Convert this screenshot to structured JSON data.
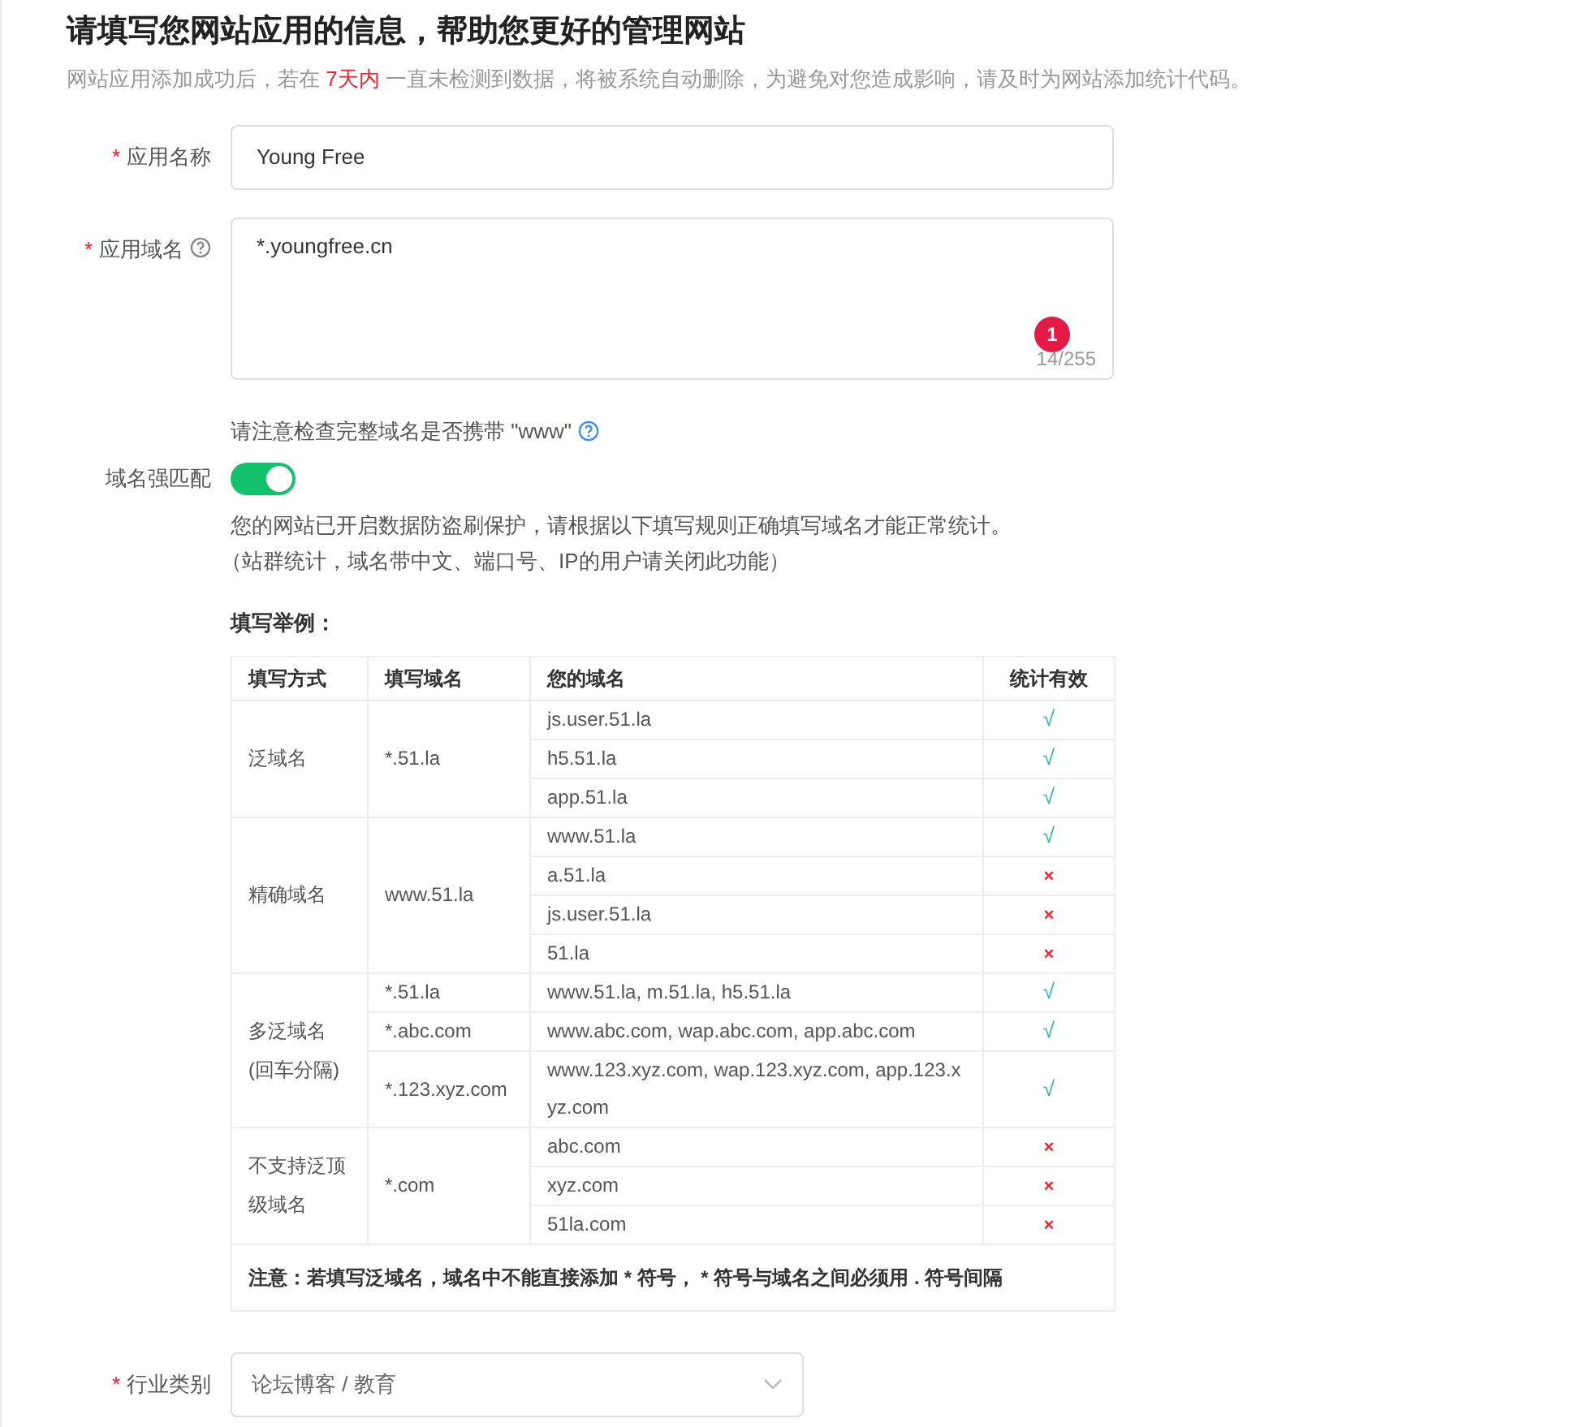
{
  "heading": "请填写您网站应用的信息，帮助您更好的管理网站",
  "notice": {
    "before": "网站应用添加成功后，若在",
    "highlight": "7天内",
    "after": "一直未检测到数据，将被系统自动删除，为避免对您造成影响，请及时为网站添加统计代码。"
  },
  "app_name": {
    "label": "应用名称",
    "required_mark": "*",
    "value": "Young Free"
  },
  "app_domain": {
    "label": "应用域名",
    "required_mark": "*",
    "value": "*.youngfree.cn",
    "counter": "14/255",
    "badge": "1",
    "hint": "请注意检查完整域名是否携带 \"www\""
  },
  "strict_match": {
    "label": "域名强匹配",
    "on": true,
    "description": [
      "您的网站已开启数据防盗刷保护，请根据以下填写规则正确填写域名才能正常统计。",
      "（站群统计，域名带中文、端口号、IP的用户请关闭此功能）"
    ]
  },
  "examples": {
    "title": "填写举例：",
    "columns": [
      "填写方式",
      "填写域名",
      "您的域名",
      "统计有效"
    ],
    "groups": [
      {
        "method": "泛域名",
        "entries": [
          {
            "filled": "*.51.la",
            "domains": [
              {
                "domain": "js.user.51.la",
                "result": "√",
                "valid": true
              },
              {
                "domain": "h5.51.la",
                "result": "√",
                "valid": true
              },
              {
                "domain": "app.51.la",
                "result": "√",
                "valid": true
              }
            ]
          }
        ]
      },
      {
        "method": "精确域名",
        "entries": [
          {
            "filled": "www.51.la",
            "domains": [
              {
                "domain": "www.51.la",
                "result": "√",
                "valid": true
              },
              {
                "domain": "a.51.la",
                "result": "×",
                "valid": false
              },
              {
                "domain": "js.user.51.la",
                "result": "×",
                "valid": false
              },
              {
                "domain": "51.la",
                "result": "×",
                "valid": false
              }
            ]
          }
        ]
      },
      {
        "method": "多泛域名\n(回车分隔)",
        "entries": [
          {
            "filled": "*.51.la",
            "domains": [
              {
                "domain": "www.51.la, m.51.la, h5.51.la",
                "result": "√",
                "valid": true
              }
            ]
          },
          {
            "filled": "*.abc.com",
            "domains": [
              {
                "domain": "www.abc.com, wap.abc.com, app.abc.com",
                "result": "√",
                "valid": true
              }
            ]
          },
          {
            "filled": "*.123.xyz.com",
            "domains": [
              {
                "domain": "www.123.xyz.com, wap.123.xyz.com, app.123.xyz.com",
                "result": "√",
                "valid": true
              }
            ]
          }
        ]
      },
      {
        "method": "不支持泛顶级域名",
        "entries": [
          {
            "filled": "*.com",
            "domains": [
              {
                "domain": "abc.com",
                "result": "×",
                "valid": false
              },
              {
                "domain": "xyz.com",
                "result": "×",
                "valid": false
              },
              {
                "domain": "51la.com",
                "result": "×",
                "valid": false
              }
            ]
          }
        ]
      }
    ],
    "note": "注意：若填写泛域名，域名中不能直接添加 * 符号， * 符号与域名之间必须用 . 符号间隔"
  },
  "industry": {
    "label": "行业类别",
    "required_mark": "*",
    "value": "论坛博客 / 教育"
  }
}
